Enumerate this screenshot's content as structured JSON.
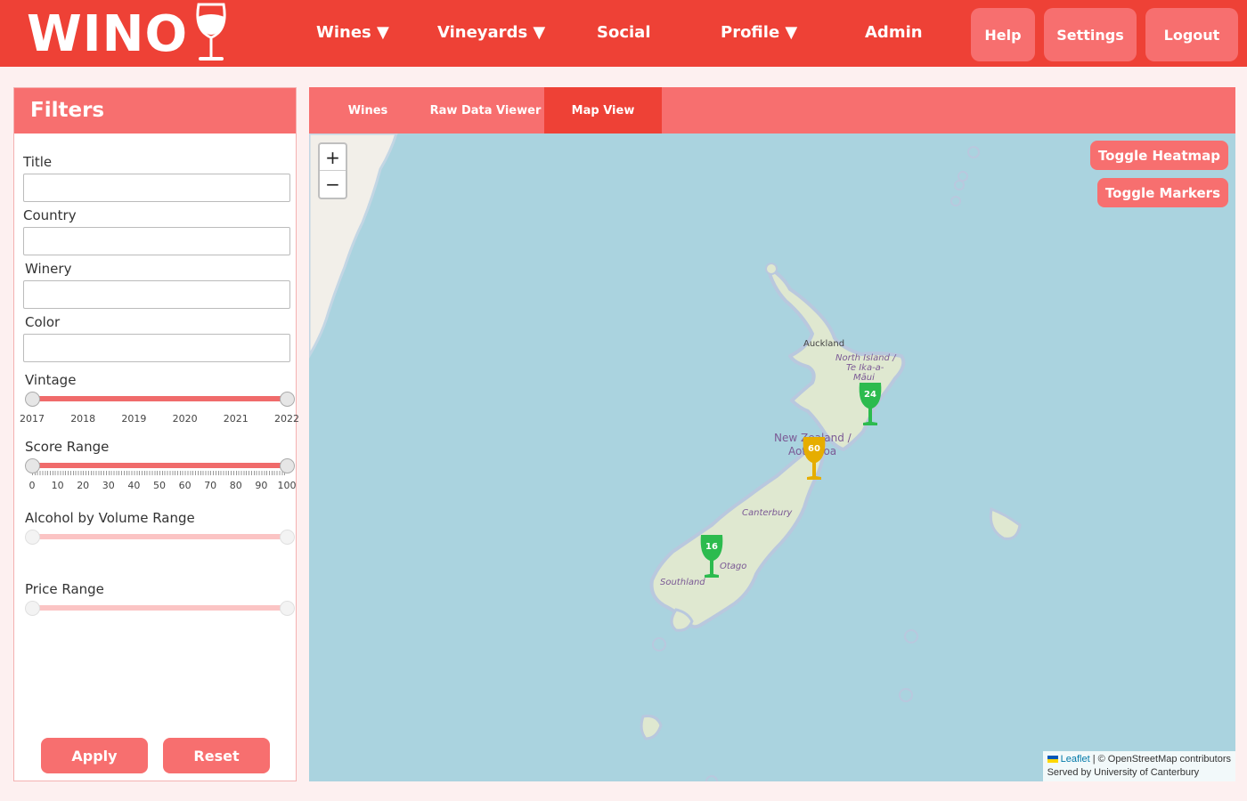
{
  "brand": {
    "name": "WINO"
  },
  "nav": {
    "wines": "Wines ▼",
    "vineyards": "Vineyards ▼",
    "social": "Social",
    "profile": "Profile ▼",
    "admin": "Admin"
  },
  "header_buttons": {
    "help": "Help",
    "settings": "Settings",
    "logout": "Logout"
  },
  "filters": {
    "title": "Filters",
    "fields": {
      "title": {
        "label": "Title",
        "value": ""
      },
      "country": {
        "label": "Country",
        "value": ""
      },
      "winery": {
        "label": "Winery",
        "value": ""
      },
      "color": {
        "label": "Color",
        "value": ""
      }
    },
    "vintage": {
      "label": "Vintage",
      "ticks": [
        "2017",
        "2018",
        "2019",
        "2020",
        "2021",
        "2022"
      ],
      "min": 2017,
      "max": 2022
    },
    "score": {
      "label": "Score Range",
      "ticks": [
        "0",
        "10",
        "20",
        "30",
        "40",
        "50",
        "60",
        "70",
        "80",
        "90",
        "100"
      ],
      "min": 0,
      "max": 100
    },
    "abv": {
      "label": "Alcohol by Volume Range"
    },
    "price": {
      "label": "Price Range"
    },
    "apply": "Apply",
    "reset": "Reset"
  },
  "tabs": {
    "wines": "Wines",
    "raw": "Raw Data Viewer",
    "map": "Map View",
    "active": "Map View"
  },
  "map": {
    "zoom_in": "+",
    "zoom_out": "−",
    "toggle_heatmap": "Toggle Heatmap",
    "toggle_markers": "Toggle Markers",
    "places": {
      "auckland": "Auckland",
      "north_island_1": "North Island /",
      "north_island_2": "Te Ika-a-",
      "north_island_3": "Māui",
      "nz_1": "New Zealand /",
      "nz_2": "Aotearoa",
      "canterbury": "Canterbury",
      "otago": "Otago",
      "southland": "Southland"
    },
    "markers": [
      {
        "count": "24",
        "color": "#2cbb4e"
      },
      {
        "count": "60",
        "color": "#e6ad00"
      },
      {
        "count": "16",
        "color": "#2cbb4e"
      }
    ],
    "attribution": {
      "leaflet": "Leaflet",
      "osm": "| © OpenStreetMap contributors",
      "served": "Served by University of Canterbury"
    }
  },
  "colors": {
    "brand_red": "#ee4136",
    "accent_pink": "#f76f6f",
    "background": "#fdf0f0",
    "map_water": "#aad3df"
  }
}
